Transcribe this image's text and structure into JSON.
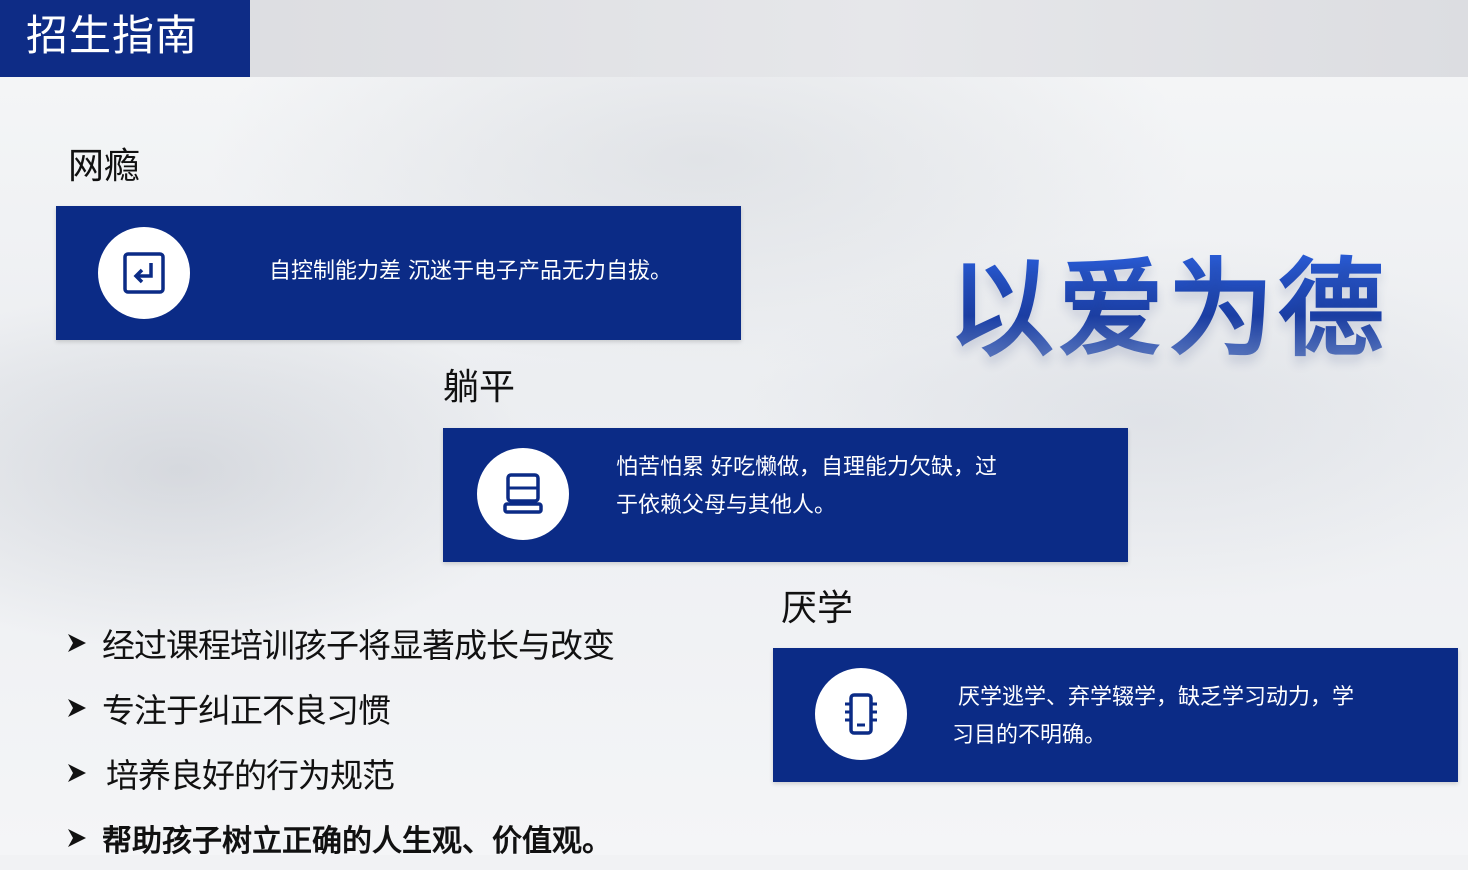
{
  "title": "招生指南",
  "slogan": "以爱为德",
  "sections": [
    {
      "heading": "网瘾",
      "icon": "enter-return-icon",
      "lines": [
        "自控制能力差 沉迷于电子产品无力自拔。"
      ]
    },
    {
      "heading": "躺平",
      "icon": "computer-icon",
      "lines": [
        "怕苦怕累 好吃懒做，自理能力欠缺，过",
        "于依赖父母与其他人。"
      ]
    },
    {
      "heading": "厌学",
      "icon": "phone-icon",
      "lines": [
        "厌学逃学、弃学辍学，缺乏学习动力，学",
        "习目的不明确。"
      ]
    }
  ],
  "bullets": [
    "经过课程培训孩子将显著成长与改变",
    "专注于纠正不良习惯",
    "培养良好的行为规范",
    "帮助孩子树立正确的人生观、价值观。"
  ],
  "colors": {
    "primary": "#0b2b86",
    "slogan": "#1f48b8"
  }
}
